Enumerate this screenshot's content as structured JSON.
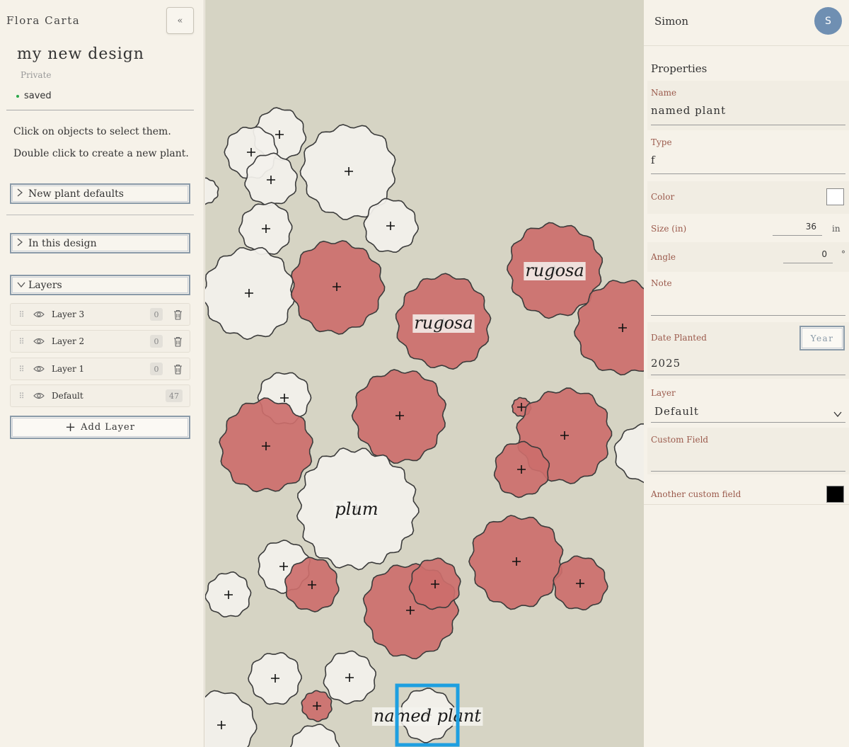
{
  "app": {
    "title": "Flora Carta",
    "collapse_label": "«"
  },
  "design": {
    "name": "my new design",
    "privacy": "Private",
    "status": "saved"
  },
  "instructions": [
    "Click on objects to select them.",
    "Double click to create a new plant."
  ],
  "sections": {
    "new_plant_defaults": "New plant defaults",
    "in_this_design": "In this design",
    "layers": "Layers"
  },
  "layers": [
    {
      "name": "Layer 3",
      "count": "0"
    },
    {
      "name": "Layer 2",
      "count": "0"
    },
    {
      "name": "Layer 1",
      "count": "0"
    },
    {
      "name": "Default",
      "count": "47"
    }
  ],
  "add_layer_label": "Add Layer",
  "user": {
    "name": "Simon",
    "initial": "S",
    "avatar_color": "#6f8fb2"
  },
  "properties": {
    "title": "Properties",
    "name_label": "Name",
    "name_value": "named plant",
    "type_label": "Type",
    "type_value": "f",
    "color_label": "Color",
    "color_value": "#ffffff",
    "size_label": "Size (in)",
    "size_value": "36",
    "size_unit": "in",
    "angle_label": "Angle",
    "angle_value": "0",
    "angle_unit": "°",
    "note_label": "Note",
    "note_value": "",
    "date_label": "Date Planted",
    "date_mode": "Year",
    "date_value": "2025",
    "layer_label": "Layer",
    "layer_value": "Default",
    "custom_label": "Custom Field",
    "custom_value": "",
    "another_label": "Another custom field",
    "another_color": "#000000"
  },
  "canvas": {
    "colors": {
      "ground": "#d6d4c4",
      "red_plant": "#cc6e6b",
      "white_plant": "#f3f1ec",
      "selection": "#1e9fe0"
    },
    "labels": [
      "rugosa",
      "rugosa",
      "plum",
      "named plant"
    ]
  }
}
